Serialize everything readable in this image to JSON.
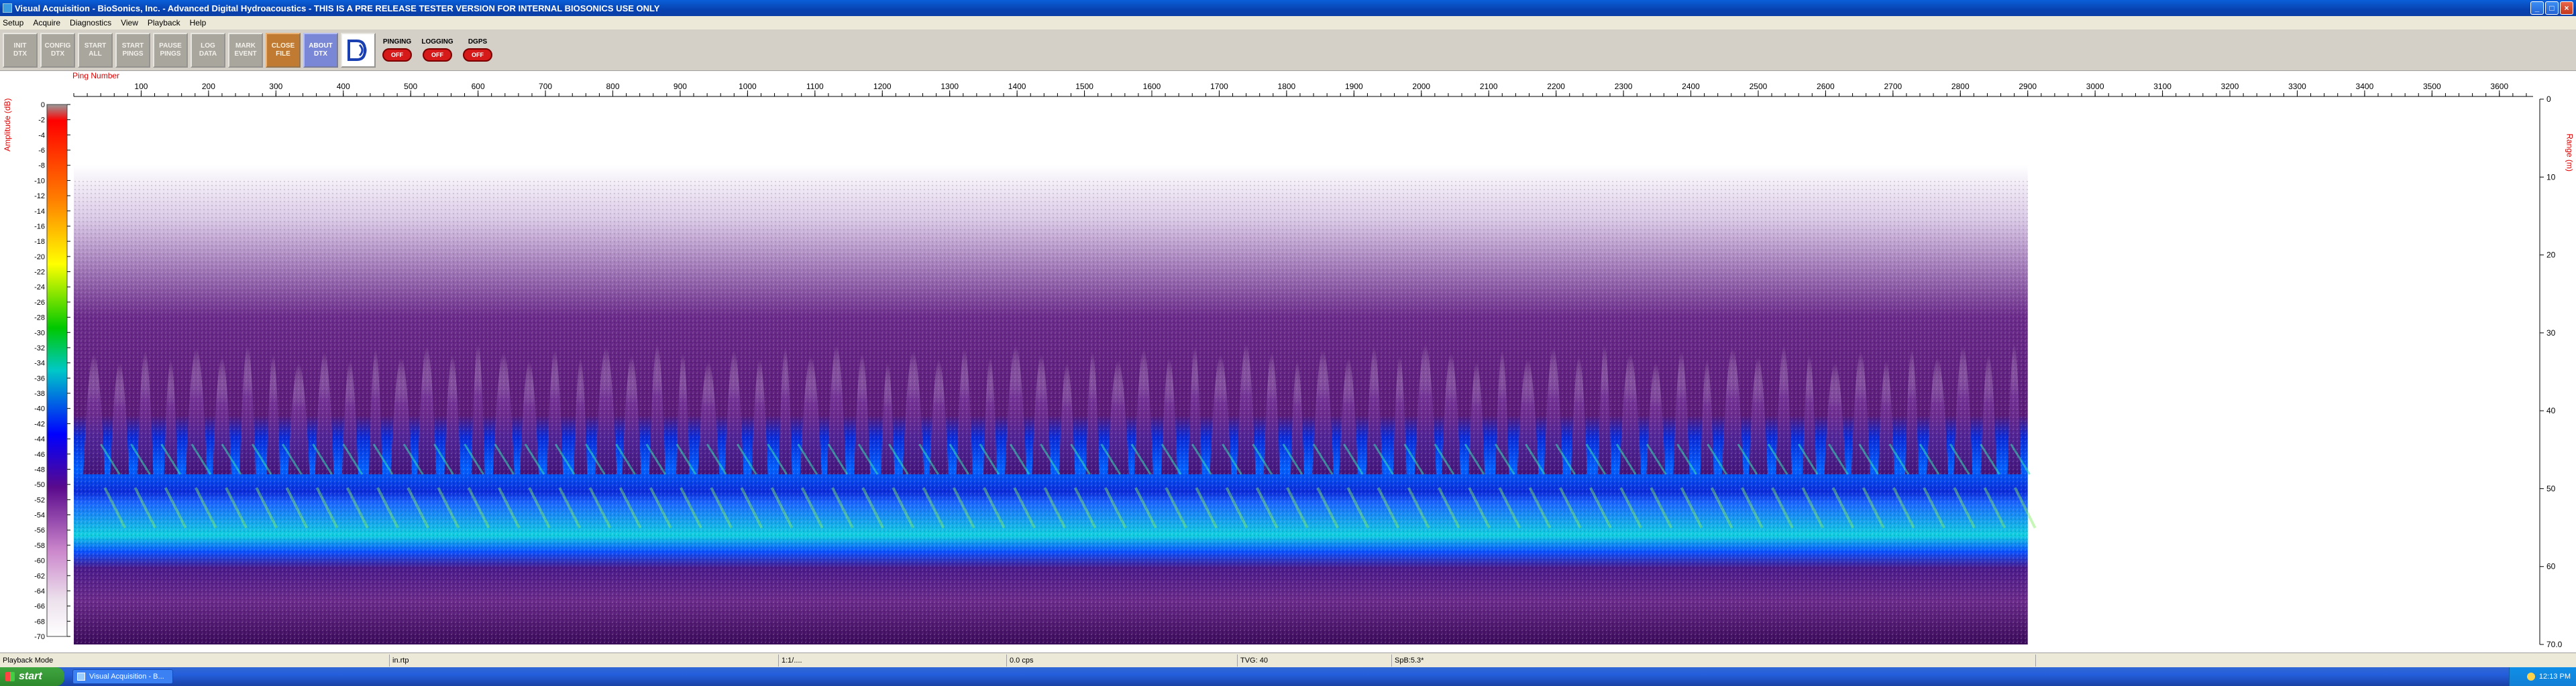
{
  "window": {
    "title": "Visual Acquisition  -  BioSonics, Inc.  -  Advanced Digital Hydroacoustics  -  THIS IS A PRE RELEASE TESTER VERSION FOR INTERNAL BIOSONICS USE ONLY",
    "min_icon": "minimize-icon",
    "max_icon": "maximize-icon",
    "close_icon": "close-icon"
  },
  "menu": [
    "Setup",
    "Acquire",
    "Diagnostics",
    "View",
    "Playback",
    "Help"
  ],
  "toolbar": {
    "buttons": [
      {
        "label": "INIT\nDTX"
      },
      {
        "label": "CONFIG\nDTX"
      },
      {
        "label": "START\nALL"
      },
      {
        "label": "START\nPINGS"
      },
      {
        "label": "PAUSE\nPINGS"
      },
      {
        "label": "LOG\nDATA"
      },
      {
        "label": "MARK\nEVENT"
      },
      {
        "label": "CLOSE\nFILE"
      },
      {
        "label": "ABOUT\nDTX"
      }
    ],
    "toggles": [
      {
        "label": "PINGING",
        "state": "OFF"
      },
      {
        "label": "LOGGING",
        "state": "OFF"
      },
      {
        "label": "DGPS",
        "state": "OFF"
      }
    ]
  },
  "echogram": {
    "ping_axis_title": "Ping Number",
    "ping_ticks": [
      100,
      200,
      300,
      400,
      500,
      600,
      700,
      800,
      900,
      1000,
      1100,
      1200,
      1300,
      1400,
      1500,
      1600,
      1700,
      1800,
      1900,
      2000,
      2100,
      2200,
      2300,
      2400,
      2500,
      2600,
      2700,
      2800,
      2900,
      3000,
      3100,
      3200,
      3300,
      3400,
      3500,
      3600
    ],
    "ping_range": [
      0,
      3650
    ],
    "data_end_ping": 2900,
    "amplitude_axis_title": "Amplitude (dB)",
    "amplitude_ticks": [
      0,
      -2,
      -4,
      -6,
      -8,
      -10,
      -12,
      -14,
      -16,
      -18,
      -20,
      -22,
      -24,
      -26,
      -28,
      -30,
      -32,
      -34,
      -36,
      -38,
      -40,
      -42,
      -44,
      -46,
      -48,
      -50,
      -52,
      -54,
      -56,
      -58,
      -60,
      -62,
      -64,
      -66,
      -68,
      -70
    ],
    "range_axis_title": "Range (m)",
    "range_ticks": [
      "0",
      "10",
      "20",
      "30",
      "40",
      "50",
      "60",
      "70.0"
    ],
    "range_max": 70
  },
  "status": [
    "Playback Mode",
    "",
    "in.rtp",
    "",
    "1:1/....",
    "",
    "0.0 cps",
    "TVG: 40",
    "SpB:5.3*",
    ""
  ],
  "taskbar": {
    "start_label": "start",
    "task_label": "Visual Acquisition - B...",
    "clock": "12:13 PM"
  }
}
